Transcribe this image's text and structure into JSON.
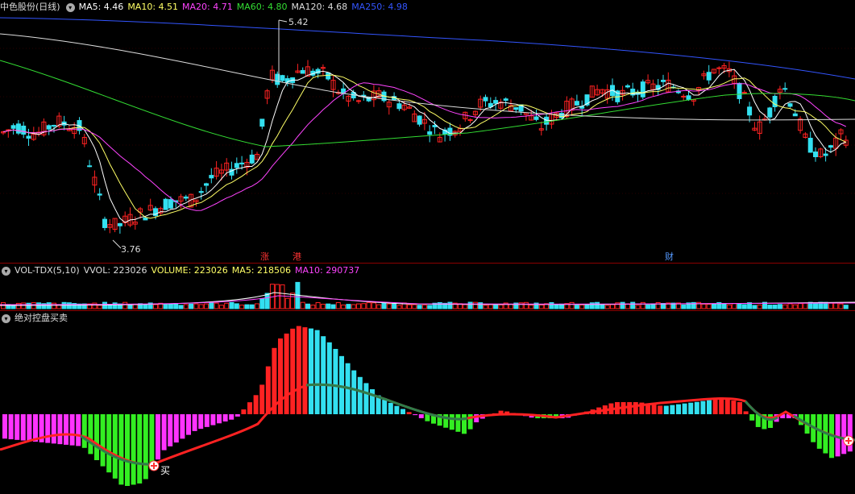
{
  "main": {
    "title": "中色股份(日线)",
    "ma": [
      {
        "label": "MA5: 4.46",
        "color": "#ffffff"
      },
      {
        "label": "MA10: 4.51",
        "color": "#ffff66"
      },
      {
        "label": "MA20: 4.71",
        "color": "#ff44ff"
      },
      {
        "label": "MA60: 4.80",
        "color": "#33dd33"
      },
      {
        "label": "MA120: 4.68",
        "color": "#dddddd"
      },
      {
        "label": "MA250: 4.98",
        "color": "#3355ff"
      }
    ],
    "high_label": "5.42",
    "low_label": "3.76",
    "markers": [
      {
        "text": "涨"
      },
      {
        "text": "港"
      },
      {
        "text": "财"
      }
    ]
  },
  "volume": {
    "header": [
      {
        "label": "VOL-TDX(5,10)",
        "color": "#dddddd"
      },
      {
        "label": "VVOL: 223026",
        "color": "#dddddd"
      },
      {
        "label": "VOLUME: 223026",
        "color": "#ffff66"
      },
      {
        "label": "MA5: 218506",
        "color": "#ffff66"
      },
      {
        "label": "MA10: 290737",
        "color": "#ff44ff"
      }
    ]
  },
  "indicator": {
    "title": "绝对控盘买卖",
    "buy_label": "买"
  },
  "colors": {
    "up": "#ff2222",
    "down": "#33e0f0",
    "ma5": "#ffffff",
    "ma10": "#ffff66",
    "ma20": "#ff44ff",
    "ma60": "#33dd33",
    "ma120": "#dddddd",
    "ma250": "#3355ff",
    "grid": "#8b0000"
  }
}
